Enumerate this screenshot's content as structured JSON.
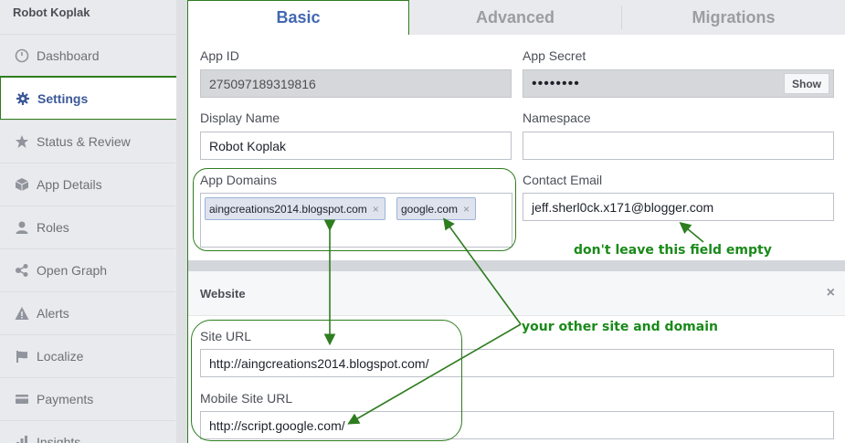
{
  "sidebar": {
    "app_name": "Robot Koplak",
    "items": [
      {
        "label": "Dashboard",
        "icon": "dashboard-icon"
      },
      {
        "label": "Settings",
        "icon": "gear-icon"
      },
      {
        "label": "Status & Review",
        "icon": "star-icon"
      },
      {
        "label": "App Details",
        "icon": "cube-icon"
      },
      {
        "label": "Roles",
        "icon": "person-icon"
      },
      {
        "label": "Open Graph",
        "icon": "share-graph-icon"
      },
      {
        "label": "Alerts",
        "icon": "warning-icon"
      },
      {
        "label": "Localize",
        "icon": "flag-icon"
      },
      {
        "label": "Payments",
        "icon": "card-icon"
      },
      {
        "label": "Insights",
        "icon": "chart-icon"
      }
    ]
  },
  "tabs": [
    "Basic",
    "Advanced",
    "Migrations"
  ],
  "form": {
    "app_id_label": "App ID",
    "app_id_value": "275097189319816",
    "app_secret_label": "App Secret",
    "app_secret_value": "••••••••",
    "show_label": "Show",
    "display_name_label": "Display Name",
    "display_name_value": "Robot Koplak",
    "namespace_label": "Namespace",
    "namespace_value": "",
    "app_domains_label": "App Domains",
    "domains": [
      "aingcreations2014.blogspot.com",
      "google.com"
    ],
    "remove_symbol": "×",
    "contact_email_label": "Contact Email",
    "contact_email_value": "jeff.sherl0ck.x171@blogger.com"
  },
  "website": {
    "title": "Website",
    "close_symbol": "×",
    "site_url_label": "Site URL",
    "site_url_value": "http://aingcreations2014.blogspot.com/",
    "mobile_site_url_label": "Mobile Site URL",
    "mobile_site_url_value": "http://script.google.com/"
  },
  "annotations": {
    "email_note": "don't leave this field empty",
    "domain_note": "your other site and domain",
    "color": "#1a8a1a"
  }
}
